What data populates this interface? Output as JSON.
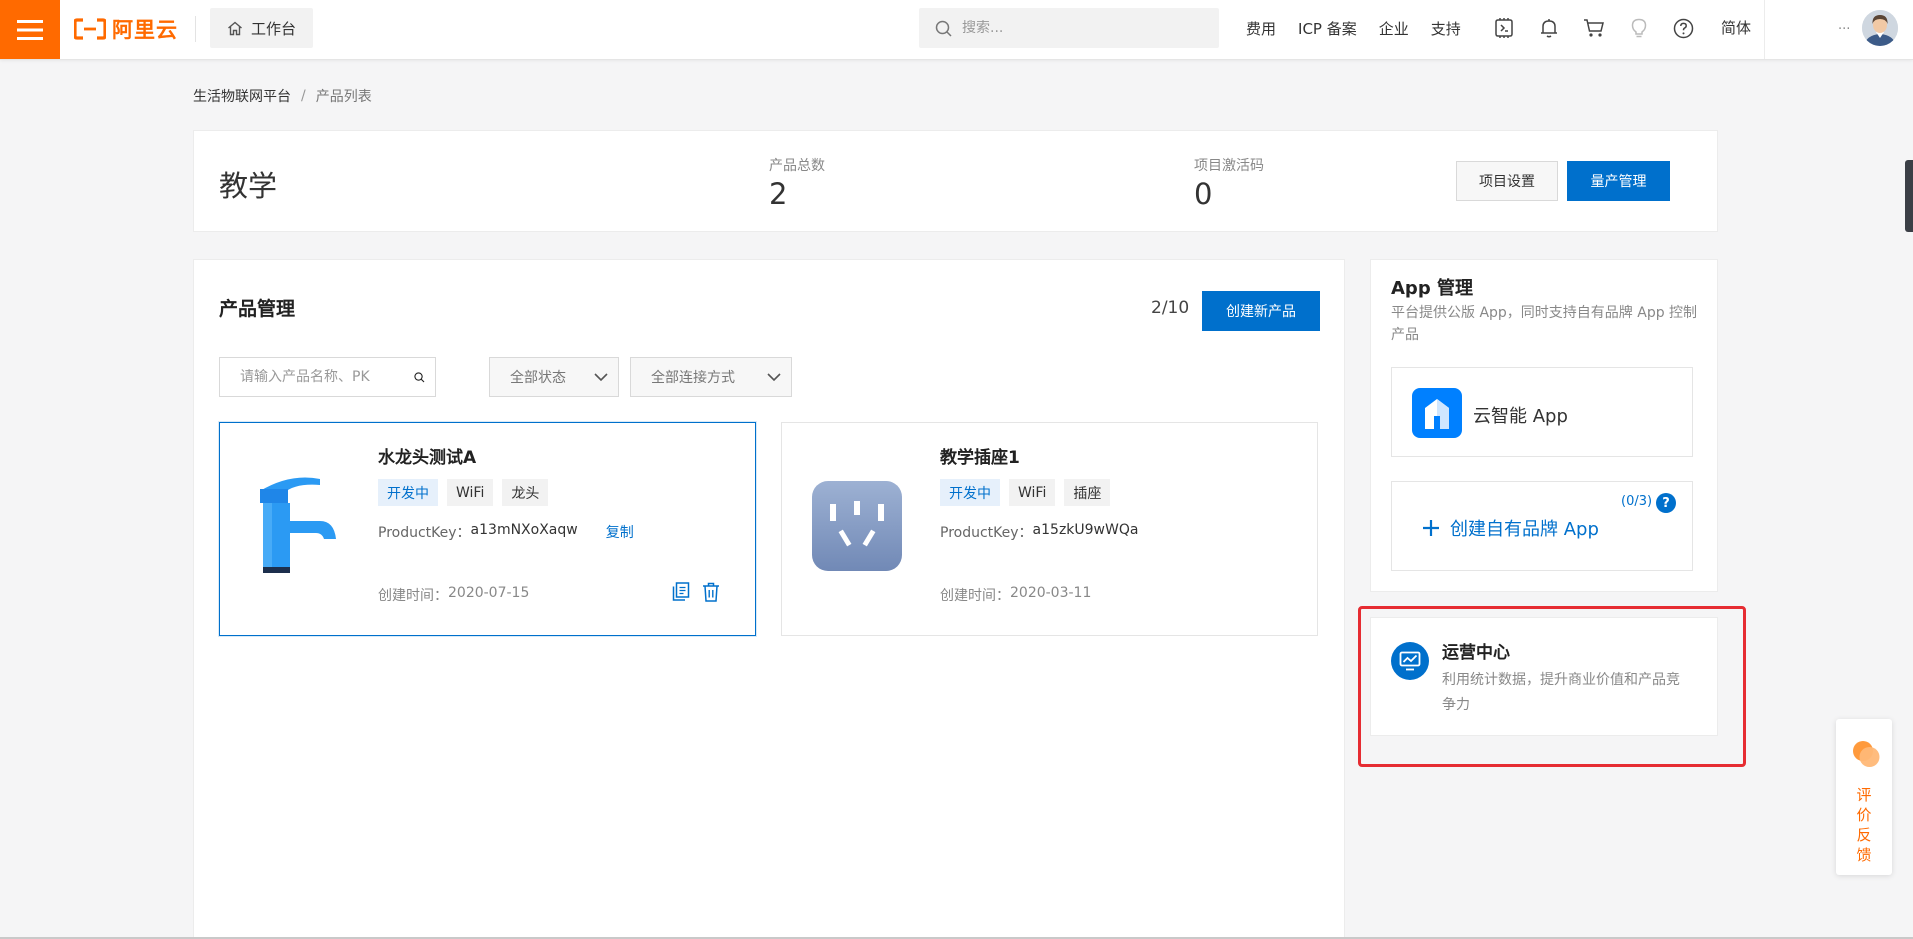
{
  "topbar": {
    "logo_text": "阿里云",
    "workbench_label": "工作台",
    "search_placeholder": "搜索...",
    "nav_links": [
      "费用",
      "ICP 备案",
      "企业",
      "支持"
    ],
    "language": "简体",
    "account_ellipsis": "...",
    "brand_color": "#ff6a00"
  },
  "breadcrumb": {
    "parent": "生活物联网平台",
    "separator": "/",
    "current": "产品列表"
  },
  "project": {
    "title": "教学",
    "stats": [
      {
        "label": "产品总数",
        "value": "2"
      },
      {
        "label": "项目激活码",
        "value": "0"
      }
    ],
    "settings_label": "项目设置",
    "mass_production_label": "量产管理"
  },
  "products": {
    "title": "产品管理",
    "quota": "2/10",
    "create_label": "创建新产品",
    "search_placeholder": "请输入产品名称、PK",
    "status_filter": "全部状态",
    "connect_filter": "全部连接方式",
    "items": [
      {
        "name": "水龙头测试A",
        "tags": [
          "开发中",
          "WiFi",
          "龙头"
        ],
        "pk_label": "ProductKey：",
        "pk_value": "a13mNXoXaqw",
        "copy_label": "复制",
        "created_label": "创建时间：",
        "created_value": "2020-07-15",
        "icon": "faucet-icon"
      },
      {
        "name": "教学插座1",
        "tags": [
          "开发中",
          "WiFi",
          "插座"
        ],
        "pk_label": "ProductKey：",
        "pk_value": "a15zkU9wWQa",
        "created_label": "创建时间：",
        "created_value": "2020-03-11",
        "icon": "socket-icon"
      }
    ]
  },
  "app_panel": {
    "title": "App 管理",
    "description": "平台提供公版 App，同时支持自有品牌 App 控制产品",
    "yun_app_label": "云智能 App",
    "create_brand_label": "创建自有品牌 App",
    "brand_count": "(0/3)",
    "help_symbol": "?"
  },
  "ops": {
    "title": "运营中心",
    "description": "利用统计数据，提升商业价值和产品竞争力"
  },
  "feedback": {
    "label": "评价反馈"
  },
  "colors": {
    "primary": "#0070cc",
    "highlight": "#e62c32"
  }
}
